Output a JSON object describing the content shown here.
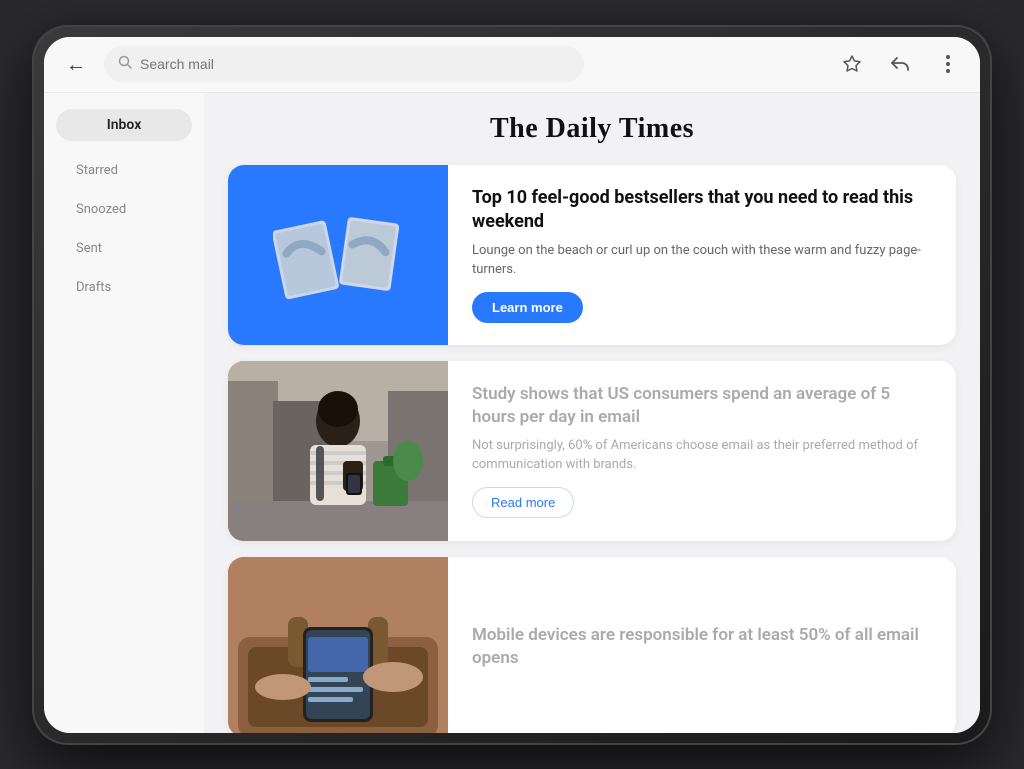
{
  "topbar": {
    "search_placeholder": "Search mail",
    "back_label": "←",
    "star_icon": "☆",
    "reply_icon": "↩",
    "menu_icon": "⋮"
  },
  "sidebar": {
    "inbox_label": "Inbox",
    "items": [
      {
        "label": "Starred"
      },
      {
        "label": "Snoozed"
      },
      {
        "label": "Sent"
      },
      {
        "label": "Drafts"
      }
    ]
  },
  "email": {
    "publication_title": "The Daily Times",
    "articles": [
      {
        "id": "article-1",
        "image_type": "blue_logo",
        "title": "Top 10 feel-good bestsellers that you need to read this weekend",
        "description": "Lounge on the beach or curl up on the couch with these warm and fuzzy page-turners.",
        "cta_label": "Learn more",
        "cta_type": "primary"
      },
      {
        "id": "article-2",
        "image_type": "person_phone",
        "title": "Study shows that US consumers spend an average of 5 hours per day in email",
        "description": "Not surprisingly, 60% of Americans choose email as their preferred method of communication with brands.",
        "cta_label": "Read more",
        "cta_type": "secondary"
      },
      {
        "id": "article-3",
        "image_type": "mobile_device",
        "title": "Mobile devices are responsible for at least 50% of all email opens",
        "description": "",
        "cta_label": "",
        "cta_type": ""
      }
    ]
  }
}
